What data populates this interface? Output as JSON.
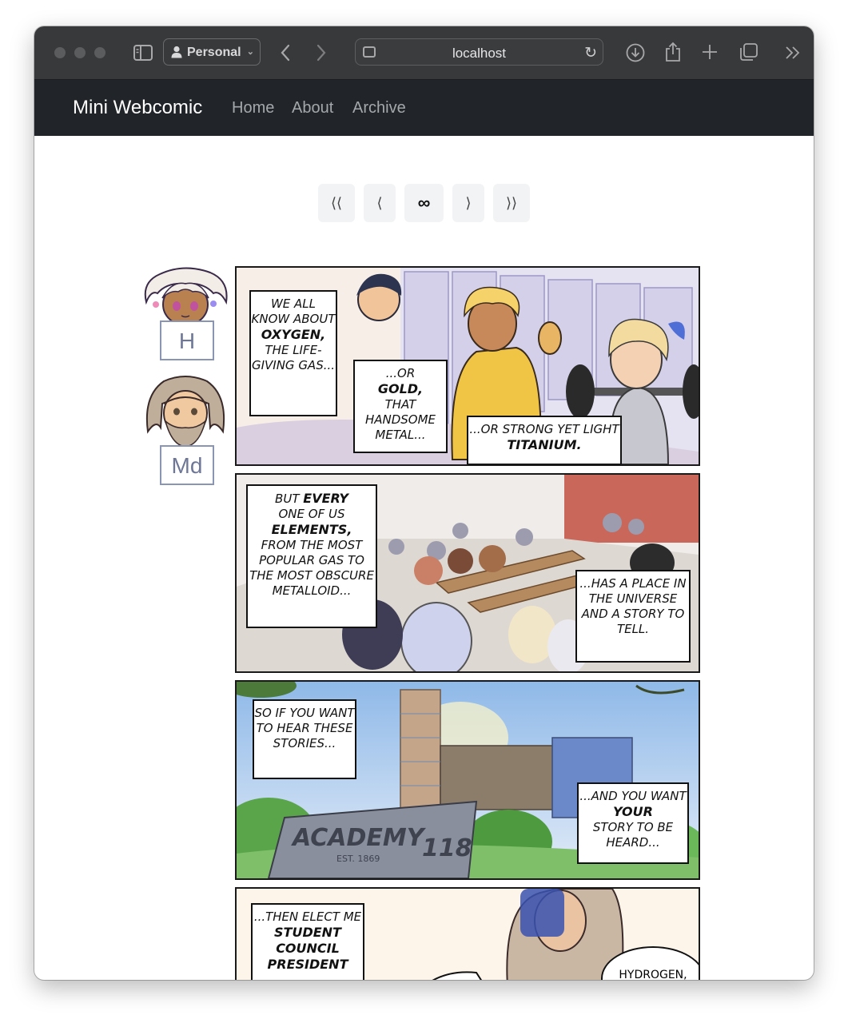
{
  "browser": {
    "profile_label": "Personal",
    "url": "localhost"
  },
  "site": {
    "brand": "Mini Webcomic",
    "nav": [
      "Home",
      "About",
      "Archive"
    ]
  },
  "comic_nav": {
    "first": "⟨⟨",
    "prev": "⟨",
    "random": "∞",
    "next": "⟩",
    "last": "⟩⟩"
  },
  "characters": [
    {
      "symbol": "H"
    },
    {
      "symbol": "Md"
    }
  ],
  "panels": {
    "p1": {
      "cap1_a": "We all know about",
      "cap1_b": "Oxygen,",
      "cap1_c": "the life-giving gas...",
      "cap2_a": "...or",
      "cap2_b": "gold,",
      "cap2_c": "that handsome metal...",
      "cap3_a": "...or strong yet light",
      "cap3_b": "titanium."
    },
    "p2": {
      "cap1_a": "But",
      "cap1_b": "every",
      "cap1_c": "one of us",
      "cap1_d": "elements,",
      "cap1_e": "from the most popular gas to the most obscure metalloid...",
      "cap2": "...has a place in the universe and a story to tell."
    },
    "p3": {
      "cap1": "So if you want to hear these stories...",
      "cap2_a": "...and you want",
      "cap2_b": "your",
      "cap2_c": "story to be heard...",
      "sign": "ACADEMY",
      "sign_num": "118",
      "sign_est": "EST. 1869"
    },
    "p4": {
      "cap1_a": "...then elect me",
      "cap1_b": "student council president",
      "bubble": "HYDROGEN,"
    }
  }
}
